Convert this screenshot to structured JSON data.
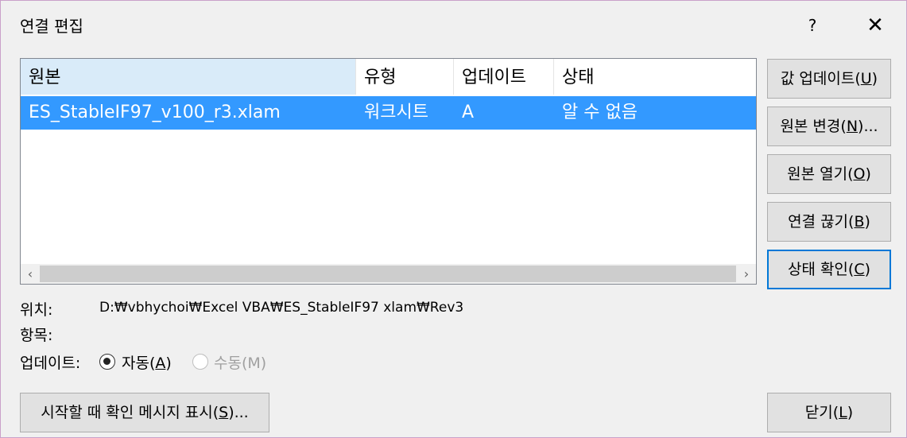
{
  "window": {
    "title": "연결 편집",
    "help_label": "?",
    "close_label": "✕"
  },
  "list": {
    "columns": [
      "원본",
      "유형",
      "업데이트",
      "상태"
    ],
    "rows": [
      {
        "source": "ES_StableIF97_v100_r3.xlam",
        "type": "워크시트",
        "update": "A",
        "status": "알 수 없음"
      }
    ],
    "scroll_left": "‹",
    "scroll_right": "›"
  },
  "buttons": {
    "update_values": {
      "text": "값 업데이트(",
      "key": "U",
      "tail": ")"
    },
    "change_source": {
      "text": "원본 변경(",
      "key": "N",
      "tail": ")..."
    },
    "open_source": {
      "text": "원본 열기(",
      "key": "O",
      "tail": ")"
    },
    "break_link": {
      "text": "연결 끊기(",
      "key": "B",
      "tail": ")"
    },
    "check_status": {
      "text": "상태 확인(",
      "key": "C",
      "tail": ")"
    },
    "startup_prompt": {
      "text": "시작할 때 확인 메시지 표시(",
      "key": "S",
      "tail": ")..."
    },
    "close": {
      "text": "닫기(",
      "key": "L",
      "tail": ")"
    }
  },
  "info": {
    "location_label": "위치:",
    "location_value": "D:₩vbhychoi₩Excel VBA₩ES_StableIF97 xlam₩Rev3",
    "item_label": "항목:",
    "update_label": "업데이트:"
  },
  "update_mode": {
    "automatic": {
      "text": "자동(",
      "key": "A",
      "tail": ")",
      "selected": true
    },
    "manual": {
      "text": "수동(M)",
      "selected": false,
      "disabled": true
    }
  }
}
